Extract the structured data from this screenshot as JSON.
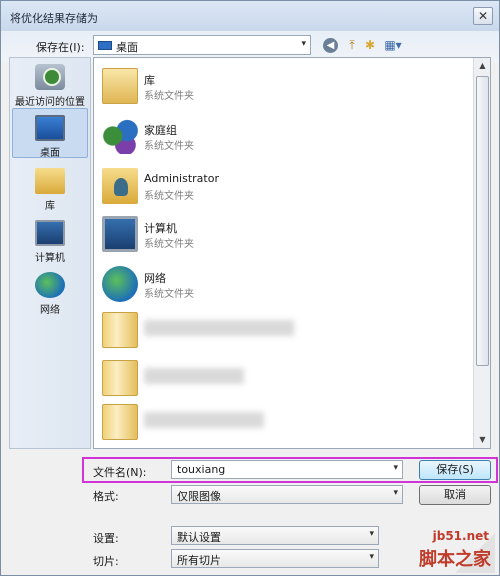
{
  "window": {
    "title": "将优化结果存储为",
    "close_glyph": "✕"
  },
  "toolbar": {
    "save_in_label": "保存在(I):",
    "location": "桌面",
    "back_glyph": "◀",
    "up_glyph": "⤒",
    "newfolder_glyph": "✱",
    "views_glyph": "▦▾"
  },
  "places": [
    {
      "label": "最近访问的位置",
      "icon": "recent-places-icon"
    },
    {
      "label": "桌面",
      "icon": "desktop-icon",
      "selected": true
    },
    {
      "label": "库",
      "icon": "library-icon"
    },
    {
      "label": "计算机",
      "icon": "computer-icon"
    },
    {
      "label": "网络",
      "icon": "network-icon"
    }
  ],
  "files": [
    {
      "name": "库",
      "kind": "系统文件夹",
      "icon": "library-folder-icon"
    },
    {
      "name": "家庭组",
      "kind": "系统文件夹",
      "icon": "homegroup-icon"
    },
    {
      "name": "Administrator",
      "kind": "系统文件夹",
      "icon": "user-folder-icon"
    },
    {
      "name": "计算机",
      "kind": "系统文件夹",
      "icon": "computer-icon"
    },
    {
      "name": "网络",
      "kind": "系统文件夹",
      "icon": "network-icon"
    }
  ],
  "form": {
    "filename_label": "文件名(N):",
    "filename_value": "touxiang",
    "format_label": "格式:",
    "format_value": "仅限图像",
    "settings_label": "设置:",
    "settings_value": "默认设置",
    "slices_label": "切片:",
    "slices_value": "所有切片",
    "dropdown_glyph": "▾"
  },
  "buttons": {
    "save": "保存(S)",
    "cancel": "取消"
  },
  "watermark": {
    "url": "jb51.net",
    "name": "脚本之家"
  },
  "colors": {
    "highlight": "#d033d6",
    "selection": "#c9dbf0"
  }
}
